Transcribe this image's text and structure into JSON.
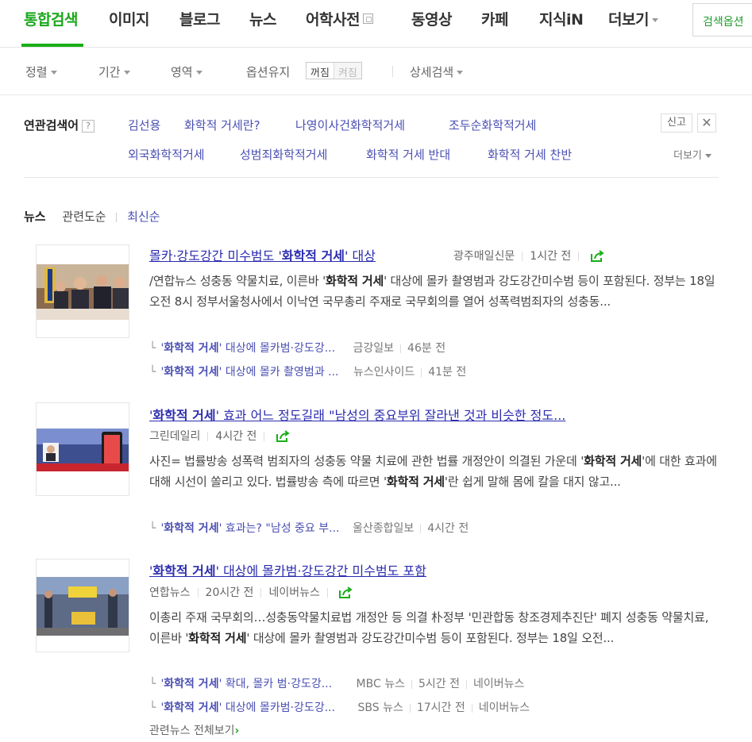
{
  "tabs": [
    {
      "label": "통합검색",
      "active": true
    },
    {
      "label": "이미지"
    },
    {
      "label": "블로그"
    },
    {
      "label": "뉴스"
    },
    {
      "label": "어학사전"
    },
    {
      "label": "동영상"
    },
    {
      "label": "카페"
    },
    {
      "label": "지식iN"
    },
    {
      "label": "더보기"
    }
  ],
  "search_options_button": "검색옵션",
  "sortbar": {
    "sort": "정렬",
    "period": "기간",
    "area": "영역",
    "keep_option": "옵션유지",
    "toggle_off": "꺼짐",
    "toggle_on": "켜짐",
    "detail": "상세검색"
  },
  "related": {
    "title": "연관검색어",
    "help": "?",
    "keywords": [
      "김선용",
      "화학적 거세란?",
      "나영이사건화학적거세",
      "조두순화학적거세",
      "외국화학적거세",
      "성범죄화학적거세",
      "화학적 거세 반대",
      "화학적 거세 찬반"
    ],
    "report": "신고",
    "close": "✕",
    "more": "더보기"
  },
  "news_header": {
    "title": "뉴스",
    "sort_related": "관련도순",
    "sort_latest": "최신순"
  },
  "news": [
    {
      "title_pre": "몰카·강도강간 미수범도 '",
      "title_bold": "화학적 거세",
      "title_post": "' 대상",
      "source": "광주매일신문",
      "time": "1시간 전",
      "desc_1": "/연합뉴스 성충동 약물치료, 이른바 '",
      "desc_2": "화학적 거세",
      "desc_3": "' 대상에 몰카 촬영범과 강도강간미수범 등이 포함된다. 정부는 18일 오전 8시 정부서울청사에서 이낙연 국무총리 주재로 국무회의를 열어 성폭력범죄자의 성충동...",
      "subs": [
        {
          "q1": "'",
          "b": "화학적 거세",
          "q2": "' 대상에 몰카범·강도강...",
          "src": "금강일보",
          "time": "46분 전"
        },
        {
          "q1": "'",
          "b": "화학적 거세",
          "q2": "' 대상에 몰카 촬영범과 ...",
          "src": "뉴스인사이드",
          "time": "41분 전"
        }
      ]
    },
    {
      "title_pre": "'",
      "title_bold": "화학적 거세",
      "title_post": "' 효과 어느 정도길래 \"남성의 중요부위 잘라낸 것과 비슷한 정도...",
      "source": "그린데일리",
      "time": "4시간 전",
      "desc_1": "사진= 법률방송 성폭력 범죄자의 성충동 약물 치료에 관한 법률 개정안이 의결된 가운데 '",
      "desc_2": "화학적 거세",
      "desc_3": "'에 대한 효과에 대해 시선이 쏠리고 있다. 법률방송 측에 따르면 '",
      "desc_4": "화학적 거세",
      "desc_5": "'란 쉽게 말해 몸에 칼을 대지 않고...",
      "subs": [
        {
          "q1": "'",
          "b": "화학적 거세",
          "q2": "' 효과는? \"남성 중요 부...",
          "src": "울산종합일보",
          "time": "4시간 전"
        }
      ]
    },
    {
      "title_pre": "'",
      "title_bold": "화학적 거세",
      "title_post": "' 대상에 몰카범·강도강간 미수범도 포함",
      "source": "연합뉴스",
      "time": "20시간 전",
      "portal": "네이버뉴스",
      "desc_1": "이총리 주재 국무회의…성충동약물치료법 개정안 등 의결 朴정부 '민관합동 창조경제추진단' 폐지 성충동 약물치료, 이른바 '",
      "desc_2": "화학적 거세",
      "desc_3": "' 대상에 몰카 촬영범과 강도강간미수범 등이 포함된다. 정부는 18일 오전...",
      "subs": [
        {
          "q1": "'",
          "b": "화학적 거세",
          "q2": "' 확대, 몰카 범·강도강...",
          "src": "MBC 뉴스",
          "time": "5시간 전",
          "portal": "네이버뉴스"
        },
        {
          "q1": "'",
          "b": "화학적 거세",
          "q2": "' 대상에 몰카범·강도강...",
          "src": "SBS 뉴스",
          "time": "17시간 전",
          "portal": "네이버뉴스"
        }
      ],
      "all_news": "관련뉴스 전체보기"
    }
  ],
  "colors": {
    "accent": "#19ae18",
    "link": "#2b2bb0",
    "related_link": "#4a4fb3"
  }
}
